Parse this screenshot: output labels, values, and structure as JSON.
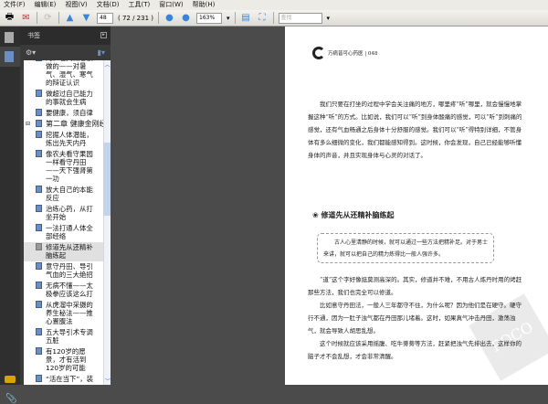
{
  "menu": [
    "文件(F)",
    "编辑(E)",
    "视图(V)",
    "文档(D)",
    "工具(T)",
    "窗口(W)",
    "帮助(H)"
  ],
  "toolbar": {
    "page_input": "48",
    "page_count": "( 72 / 231 )",
    "zoom": "163%",
    "search_placeholder": "查找"
  },
  "panel": {
    "title": "书签"
  },
  "bookmarks": [
    {
      "label": "的，老天做它该做的——对暑气、湿气、寒气的辩证认识",
      "chapter": false
    },
    {
      "label": "做超过自己能力的事就会生病",
      "chapter": false
    },
    {
      "label": "要健康，须自律",
      "chapter": false
    },
    {
      "label": "第二章 健康金刚经",
      "chapter": true
    },
    {
      "label": "挖掘人体潜能，炼出先天内丹",
      "chapter": false
    },
    {
      "label": "像农夫看守果园一样看守丹田——天下强肾第一功",
      "chapter": false
    },
    {
      "label": "放大自己的本能反应",
      "chapter": false
    },
    {
      "label": "治练心药，从打坐开始",
      "chapter": false
    },
    {
      "label": "一法打通人体全部经络",
      "chapter": false
    },
    {
      "label": "修道先从还精补脑练起",
      "chapter": false,
      "selected": true
    },
    {
      "label": "意守丹田、导引气血的三大绝招",
      "chapter": false
    },
    {
      "label": "无病不懂——太极拳应该这么打",
      "chapter": false
    },
    {
      "label": "从虎溜中采摄的养生秘法——推心置腹法",
      "chapter": false
    },
    {
      "label": "五大导引术专调五脏",
      "chapter": false
    },
    {
      "label": "有120岁的愿景，才有活到120岁的可能",
      "chapter": false
    },
    {
      "label": "“活在当下”，装",
      "chapter": false
    }
  ],
  "document": {
    "header": "万病皆可心药医 | 048",
    "para1": "我们只要在打坐的过程中学会关注痛的地方，哪里疼“听”哪里，就会慢慢地掌握这种“听”的方式。比如说，我们可以“听”到身体酸痛的感觉，可以“听”到刺痛的感觉，还有气血畅通之后身体十分舒服的感觉。我们可以“听”得特别详细，不管身体有多么细微的变化，我们都能感知得到。这时候，你会发现，自己已经能够听懂身体的声音，并且实现身体与心灵的对话了。",
    "section_title": "修道先从还精补脑练起",
    "quote": "古人心里清静的时候，就可以通过一些方法把精补足。对于男士来讲，就可以把自己的精力炼得比一般人强许多。",
    "para2": "“道”这个字好像挺莫测高深的。其实，修道并不难，不用古人炼丹时用的烤赶那些方法，我们也完全可以修道。",
    "para3": "比如意守丹田法，一般人三年都守不住，为什么呢？因为他们是在硬守。硬守行不通，因为一肚子浊气都在丹田那儿堵着。这时，如果真气冲击丹田，激荡浊气，就会导致人胡思乱想。",
    "para4": "这个时候就应该采用摇腹、吃牛蒡蒡等方法，赶紧把浊气先排出去，这样你的脑子才不会乱想，才会非常清醒。"
  }
}
